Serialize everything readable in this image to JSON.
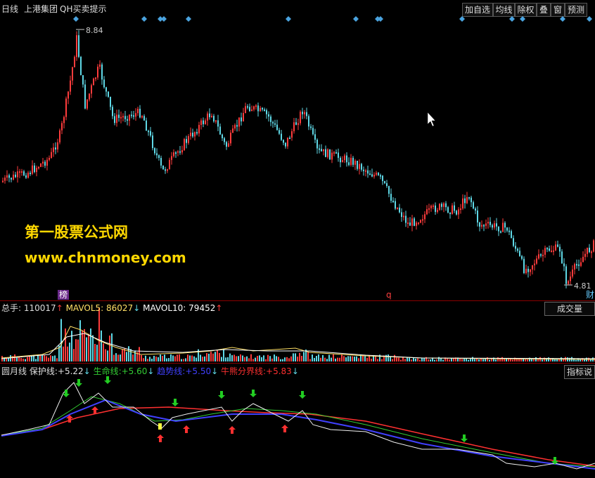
{
  "header": {
    "period": "日线",
    "stock_name": "上港集团",
    "indicator": "QH买卖提示",
    "buttons": [
      "加自选",
      "均线",
      "除权",
      "叠",
      "窗",
      "预测"
    ]
  },
  "price_panel": {
    "high_label": "8.84",
    "low_label": "4.81",
    "markers": [
      "榜",
      "q",
      "财"
    ],
    "watermark_title": "第一股票公式网",
    "watermark_url": "www.chnmoney.com"
  },
  "volume_panel": {
    "label": "总手:",
    "total": "110017",
    "total_arrow": "↑",
    "mavol5_label": "MAVOL5:",
    "mavol5": "86027",
    "mavol5_arrow": "↓",
    "mavol10_label": "MAVOL10:",
    "mavol10": "79452",
    "mavol10_arrow": "↑",
    "button": "成交量"
  },
  "indicator_panel": {
    "name": "圆月线",
    "items": [
      {
        "label": "保护线:",
        "value": "+5.22",
        "arrow": "↓",
        "color": "#e0e0e0"
      },
      {
        "label": "生命线:",
        "value": "+5.60",
        "arrow": "↓",
        "color": "#33cc33"
      },
      {
        "label": "趋势线:",
        "value": "+5.50",
        "arrow": "↓",
        "color": "#4040ff"
      },
      {
        "label": "牛熊分界线:",
        "value": "+5.83",
        "arrow": "↓",
        "color": "#ff3030"
      }
    ],
    "button": "指标说"
  },
  "colors": {
    "up": "#ff3c3c",
    "down": "#5fd8e6",
    "signal_diamond": "#4aa3df",
    "separator": "#8b0000",
    "watermark": "#ffd800"
  }
}
